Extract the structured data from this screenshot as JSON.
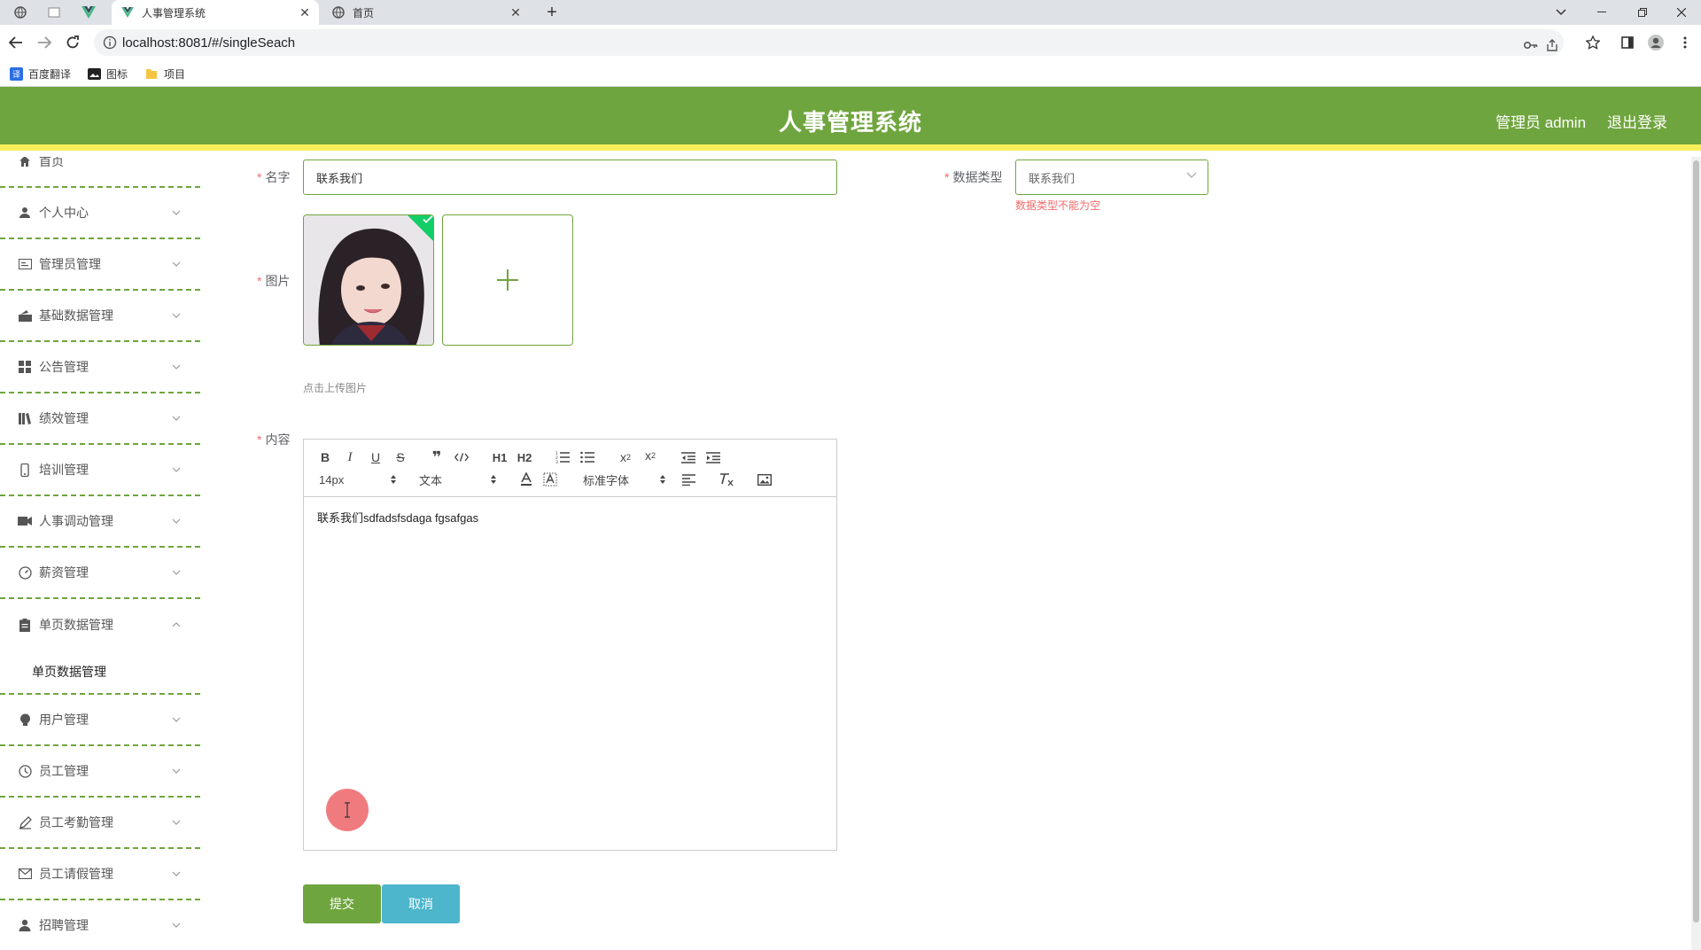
{
  "browser": {
    "tabs": [
      {
        "title": "人事管理系统",
        "active": true
      },
      {
        "title": "首页",
        "active": false
      }
    ],
    "url": "localhost:8081/#/singleSeach",
    "bookmarks": [
      {
        "label": "百度翻译",
        "icon": "translate-icon"
      },
      {
        "label": "图标",
        "icon": "image-icon"
      },
      {
        "label": "项目",
        "icon": "folder-icon"
      }
    ]
  },
  "header": {
    "title": "人事管理系统",
    "user": "管理员 admin",
    "logout": "退出登录",
    "colors": {
      "primary": "#6fa53e",
      "accent_strip": "#f5f05a"
    }
  },
  "sidebar": {
    "items": [
      {
        "label": "首页",
        "icon": "home-icon"
      },
      {
        "label": "个人中心",
        "icon": "user-icon"
      },
      {
        "label": "管理员管理",
        "icon": "id-card-icon"
      },
      {
        "label": "基础数据管理",
        "icon": "briefcase-icon"
      },
      {
        "label": "公告管理",
        "icon": "grid-icon"
      },
      {
        "label": "绩效管理",
        "icon": "library-icon"
      },
      {
        "label": "培训管理",
        "icon": "phone-icon"
      },
      {
        "label": "人事调动管理",
        "icon": "video-icon"
      },
      {
        "label": "薪资管理",
        "icon": "gauge-icon"
      },
      {
        "label": "单页数据管理",
        "icon": "clipboard-icon",
        "expanded": true
      },
      {
        "label": "用户管理",
        "icon": "bulb-icon"
      },
      {
        "label": "员工管理",
        "icon": "clock-icon"
      },
      {
        "label": "员工考勤管理",
        "icon": "pen-icon"
      },
      {
        "label": "员工请假管理",
        "icon": "mail-icon"
      },
      {
        "label": "招聘管理",
        "icon": "person-icon"
      }
    ],
    "subitem": "单页数据管理"
  },
  "form": {
    "name_label": "名字",
    "name_value": "联系我们",
    "type_label": "数据类型",
    "type_value": "联系我们",
    "type_error": "数据类型不能为空",
    "image_label": "图片",
    "upload_tip": "点击上传图片",
    "content_label": "内容",
    "content_text": "联系我们sdfadsfsdaga fgsafgas",
    "submit": "提交",
    "cancel": "取消"
  },
  "editor_toolbar": {
    "size": "14px",
    "header": "文本",
    "font": "标准字体",
    "h1": "H1",
    "h2": "H2"
  }
}
